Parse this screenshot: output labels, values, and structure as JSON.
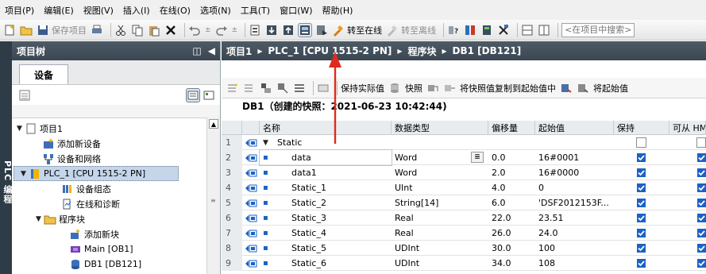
{
  "menu": [
    "项目(P)",
    "编辑(E)",
    "视图(V)",
    "插入(I)",
    "在线(O)",
    "选项(N)",
    "工具(T)",
    "窗口(W)",
    "帮助(H)"
  ],
  "toolbar": {
    "save_project": "保存项目",
    "go_online": "转至在线",
    "go_offline": "转至离线",
    "search_placeholder": "<在项目中搜索>"
  },
  "side_strip": {
    "label": "PLC 编程"
  },
  "project_tree": {
    "title": "项目树",
    "tab_devices": "设备",
    "items": [
      {
        "label": "项目1",
        "icon": "project-icon",
        "expanded": true
      },
      {
        "label": "添加新设备",
        "icon": "add-device-icon"
      },
      {
        "label": "设备和网络",
        "icon": "network-icon"
      },
      {
        "label": "PLC_1 [CPU 1515-2 PN]",
        "icon": "plc-icon",
        "expanded": true,
        "selected": true
      },
      {
        "label": "设备组态",
        "icon": "device-config-icon"
      },
      {
        "label": "在线和诊断",
        "icon": "diagnostics-icon"
      },
      {
        "label": "程序块",
        "icon": "folder-icon",
        "expanded": true
      },
      {
        "label": "添加新块",
        "icon": "add-block-icon"
      },
      {
        "label": "Main [OB1]",
        "icon": "ob-icon"
      },
      {
        "label": "DB1 [DB121]",
        "icon": "db-icon"
      }
    ]
  },
  "breadcrumb": [
    "项目1",
    "PLC_1 [CPU 1515-2 PN]",
    "程序块",
    "DB1 [DB121]"
  ],
  "editor_toolbar": {
    "keep_actual": "保持实际值",
    "snapshot": "快照",
    "copy_snapshot": "将快照值复制到起始值中",
    "copy_start": "将起始值"
  },
  "db_title": "DB1（创建的快照：2021-06-23 10:42:44)",
  "columns": [
    "名称",
    "数据类型",
    "偏移量",
    "起始值",
    "保持",
    "可从 HMI"
  ],
  "rows": [
    {
      "n": "1",
      "name": "Static",
      "type": "",
      "offset": "",
      "start": "",
      "retain": false,
      "hmi": false,
      "section": true
    },
    {
      "n": "2",
      "name": "data",
      "type": "Word",
      "offset": "0.0",
      "start": "16#0001",
      "retain": true,
      "hmi": true
    },
    {
      "n": "3",
      "name": "data1",
      "type": "Word",
      "offset": "2.0",
      "start": "16#0000",
      "retain": true,
      "hmi": true
    },
    {
      "n": "4",
      "name": "Static_1",
      "type": "UInt",
      "offset": "4.0",
      "start": "0",
      "retain": true,
      "hmi": true
    },
    {
      "n": "5",
      "name": "Static_2",
      "type": "String[14]",
      "offset": "6.0",
      "start": "'DSF2012153F...",
      "retain": true,
      "hmi": true
    },
    {
      "n": "6",
      "name": "Static_3",
      "type": "Real",
      "offset": "22.0",
      "start": "23.51",
      "retain": true,
      "hmi": true
    },
    {
      "n": "7",
      "name": "Static_4",
      "type": "Real",
      "offset": "26.0",
      "start": "24.0",
      "retain": true,
      "hmi": true
    },
    {
      "n": "8",
      "name": "Static_5",
      "type": "UDInt",
      "offset": "30.0",
      "start": "100",
      "retain": true,
      "hmi": true
    },
    {
      "n": "9",
      "name": "Static_6",
      "type": "UDInt",
      "offset": "34.0",
      "start": "108",
      "retain": true,
      "hmi": true
    }
  ],
  "colors": {
    "title_bar": "#3f4b56",
    "checkbox_blue": "#1a62c7",
    "annotation_arrow": "#e02a1e",
    "selection": "#c5d6ea"
  }
}
